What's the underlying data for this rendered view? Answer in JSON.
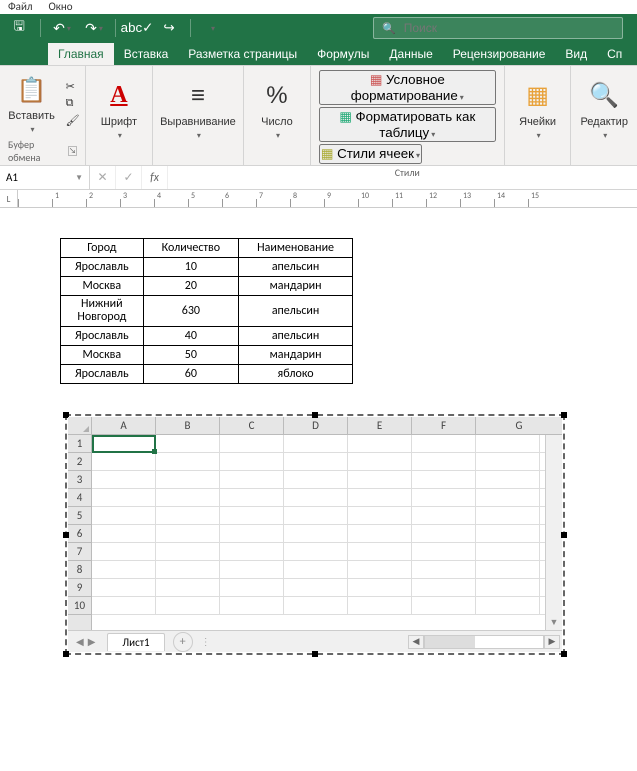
{
  "menubar": {
    "item1": "Файл",
    "item2": "Окно"
  },
  "search": {
    "placeholder": "Поиск"
  },
  "ribbon": {
    "tabs": [
      "Главная",
      "Вставка",
      "Разметка страницы",
      "Формулы",
      "Данные",
      "Рецензирование",
      "Вид",
      "Сп"
    ],
    "active_tab_index": 0,
    "groups": {
      "clipboard": {
        "paste": "Вставить",
        "label": "Буфер обмена"
      },
      "font": {
        "btn": "Шрифт"
      },
      "alignment": {
        "btn": "Выравнивание"
      },
      "number": {
        "btn": "Число",
        "symbol": "%"
      },
      "styles": {
        "conditional": "Условное форматирование",
        "format_table": "Форматировать как таблицу",
        "cell_styles": "Стили ячеек",
        "label": "Стили"
      },
      "cells": {
        "btn": "Ячейки"
      },
      "editing": {
        "btn": "Редактир"
      }
    }
  },
  "namebox": {
    "ref": "A1",
    "fx": "fx"
  },
  "ruler": {
    "marks": [
      "1",
      "2",
      "3",
      "4",
      "5",
      "6",
      "7",
      "8",
      "9",
      "10",
      "11",
      "12",
      "13",
      "14",
      "15"
    ]
  },
  "data_table": {
    "headers": [
      "Город",
      "Количество",
      "Наименование"
    ],
    "rows": [
      [
        "Ярославль",
        "10",
        "апельсин"
      ],
      [
        "Москва",
        "20",
        "мандарин"
      ],
      [
        "Нижний Новгород",
        "630",
        "апельсин"
      ],
      [
        "Ярославль",
        "40",
        "апельсин"
      ],
      [
        "Москва",
        "50",
        "мандарин"
      ],
      [
        "Ярославль",
        "60",
        "яблоко"
      ]
    ]
  },
  "embedded_sheet": {
    "cols": [
      "A",
      "B",
      "C",
      "D",
      "E",
      "F",
      "G"
    ],
    "row_count": 10,
    "tab": "Лист1"
  },
  "chart_data": {
    "type": "table",
    "title": "",
    "columns": [
      "Город",
      "Количество",
      "Наименование"
    ],
    "rows": [
      {
        "Город": "Ярославль",
        "Количество": 10,
        "Наименование": "апельсин"
      },
      {
        "Город": "Москва",
        "Количество": 20,
        "Наименование": "мандарин"
      },
      {
        "Город": "Нижний Новгород",
        "Количество": 630,
        "Наименование": "апельсин"
      },
      {
        "Город": "Ярославль",
        "Количество": 40,
        "Наименование": "апельсин"
      },
      {
        "Город": "Москва",
        "Количество": 50,
        "Наименование": "мандарин"
      },
      {
        "Город": "Ярославль",
        "Количество": 60,
        "Наименование": "яблоко"
      }
    ]
  }
}
